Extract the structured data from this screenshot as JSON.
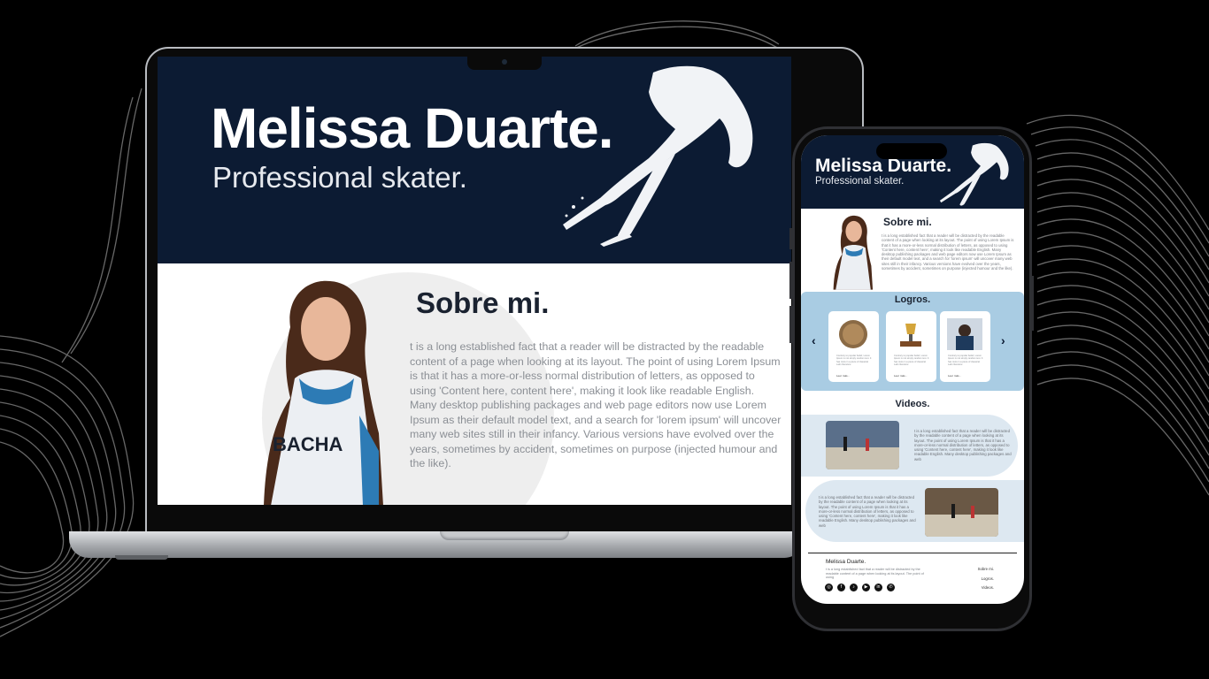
{
  "desktop": {
    "hero": {
      "title": "Melissa Duarte.",
      "subtitle": "Professional skater."
    },
    "bio": {
      "heading": "Sobre mi.",
      "text": "t is a long established fact that a reader will be distracted by the readable content of a page when looking at its layout. The point of using Lorem Ipsum is that it has a more-or-less normal distribution of letters, as opposed to using 'Content here, content here', making it look like readable English. Many desktop publishing packages and web page editors now use Lorem Ipsum as their default model text, and a search for 'lorem ipsum' will uncover many web sites still in their infancy. Various versions have evolved over the years, sometimes by accident, sometimes on purpose (injected humour and the like)."
    },
    "jersey_text": "BACHA"
  },
  "mobile": {
    "hero": {
      "title": "Melissa Duarte.",
      "subtitle": "Professional skater."
    },
    "bio": {
      "heading": "Sobre mi.",
      "text": "t is a long established fact that a reader will be distracted by the readable content of a page when looking at its layout. The point of using Lorem Ipsum is that it has a more-or-less normal distribution of letters, as opposed to using 'Content here, content here', making it look like readable English. Many desktop publishing packages and web page editors now use Lorem Ipsum as their default model text, and a search for 'lorem ipsum' will uncover many web sites still in their infancy. Various versions have evolved over the years, sometimes by accident, sometimes on purpose (injected humour and the like)."
    },
    "logros": {
      "heading": "Logros.",
      "prev_icon": "‹",
      "next_icon": "›",
      "cards": [
        {
          "text": "Contrary to popular belief, Lorem Ipsum is not simply random text. It has roots in a piece of classical Latin literature",
          "link": "Leer más..."
        },
        {
          "text": "Contrary to popular belief, Lorem Ipsum is not simply random text. It has roots in a piece of classical Latin literature",
          "link": "Leer más..."
        },
        {
          "text": "Contrary to popular belief, Lorem Ipsum is not simply random text. It has roots in a piece of classical Latin literature",
          "link": "Leer más..."
        }
      ]
    },
    "videos": {
      "heading": "Videos.",
      "items": [
        {
          "text": "t is a long established fact that a reader will be distracted by the readable content of a page when looking at its layout. The point of using Lorem Ipsum is that it has a more-or-less normal distribution of letters, as opposed to using 'Content here, content here', making it look like readable English. Many desktop publishing packages and web"
        },
        {
          "text": "t is a long established fact that a reader will be distracted by the readable content of a page when looking at its layout. The point of using Lorem Ipsum is that it has a more-or-less normal distribution of letters, as opposed to using 'Content here, content here', making it look like readable English. Many desktop publishing packages and web"
        }
      ]
    },
    "footer": {
      "name": "Melissa Duarte.",
      "text": "t is a long established fact that a reader will be distracted by the readable content of a page when looking at its layout. The point of using",
      "links": [
        "Sobre mi.",
        "Logros.",
        "Videos."
      ],
      "social_icons": [
        "instagram-icon",
        "facebook-icon",
        "tiktok-icon",
        "youtube-icon",
        "linkedin-icon",
        "whatsapp-icon"
      ],
      "social_glyphs": [
        "◎",
        "f",
        "♪",
        "▶",
        "in",
        "✆"
      ]
    }
  },
  "colors": {
    "hero_bg": "#0c1b33",
    "logros_bg": "#a9cce3",
    "video_pill_bg": "#dde8f1",
    "mockup_bg": "#000000"
  }
}
